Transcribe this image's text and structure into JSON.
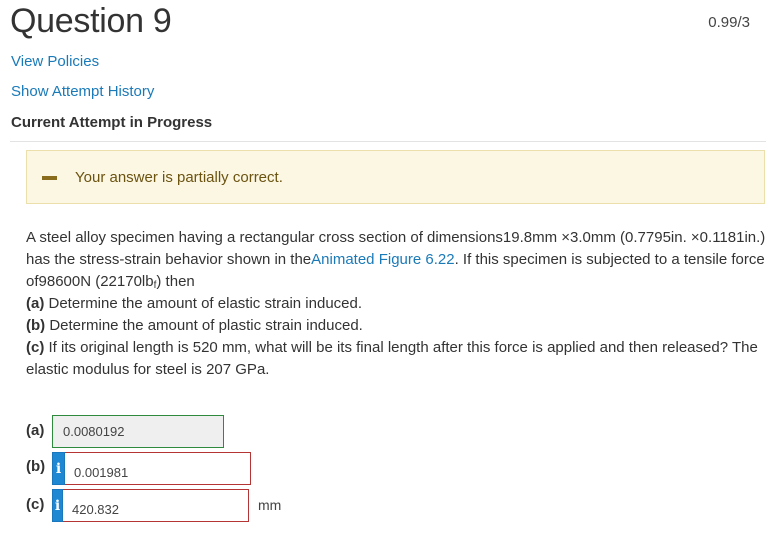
{
  "header": {
    "title": "Question 9",
    "score": "0.99/3"
  },
  "links": {
    "view_policies": "View Policies",
    "show_history": "Show Attempt History"
  },
  "current_attempt": "Current Attempt in Progress",
  "notice": {
    "message": "Your answer is partially correct."
  },
  "problem": {
    "p1": "A steel alloy specimen having a rectangular cross section of dimensions19.8mm ×3.0mm (0.7795in. ×0.1181in.) has the stress-strain behavior shown in the",
    "link": "Animated Figure 6.22",
    "p2": ". If this specimen is subjected to a tensile force of98600N (22170lb",
    "sub": "f",
    "p3": ") then",
    "a_label": "(a)",
    "a_text": " Determine the amount of elastic strain induced.",
    "b_label": "(b)",
    "b_text": " Determine the amount of plastic strain induced.",
    "c_label": "(c)",
    "c_text": " If its original length is 520 mm, what will be its final length after this force is applied and then released? The elastic modulus for steel is 207 GPa."
  },
  "answers": {
    "a": {
      "label": "(a)",
      "value": "0.0080192"
    },
    "b": {
      "label": "(b)",
      "value": "0.001981",
      "info_icon": "i"
    },
    "c": {
      "label": "(c)",
      "value": "420.832",
      "info_icon": "i",
      "unit": "mm"
    }
  },
  "colors": {
    "link": "#1a7ab8",
    "notice_bg": "#fcf7e3",
    "correct_border": "#2e8a3c",
    "incorrect_border": "#b53434",
    "info_button": "#1e88d3"
  }
}
